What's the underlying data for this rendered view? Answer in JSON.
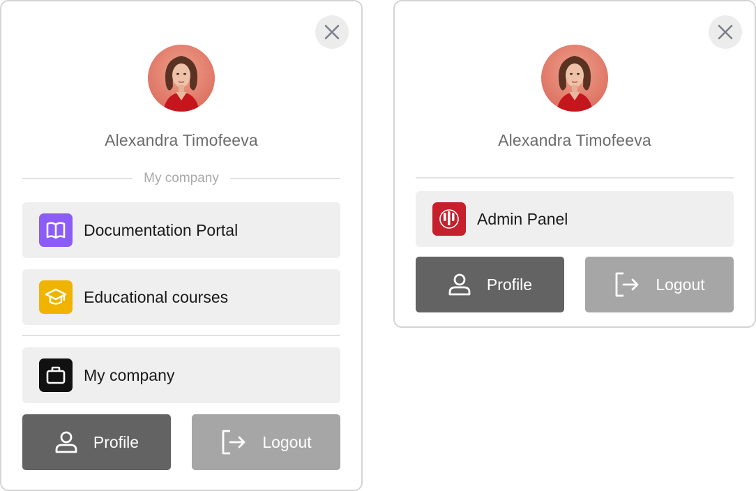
{
  "left_card": {
    "user_name": "Alexandra Timofeeva",
    "section_label": "My company",
    "menu": [
      {
        "label": "Documentation Portal",
        "icon": "book-icon",
        "icon_bg": "#8b5cf6"
      },
      {
        "label": "Educational courses",
        "icon": "graduation-cap-icon",
        "icon_bg": "#f0b400"
      },
      {
        "label": "My company",
        "icon": "briefcase-icon",
        "icon_bg": "#111111"
      }
    ],
    "profile_label": "Profile",
    "logout_label": "Logout"
  },
  "right_card": {
    "user_name": "Alexandra Timofeeva",
    "menu": [
      {
        "label": "Admin Panel",
        "icon": "admin-logo-icon",
        "icon_bg": "#c6202d"
      }
    ],
    "profile_label": "Profile",
    "logout_label": "Logout"
  },
  "colors": {
    "profile_button": "#636363",
    "logout_button": "#a6a6a6",
    "menu_item_bg": "#efefef"
  }
}
